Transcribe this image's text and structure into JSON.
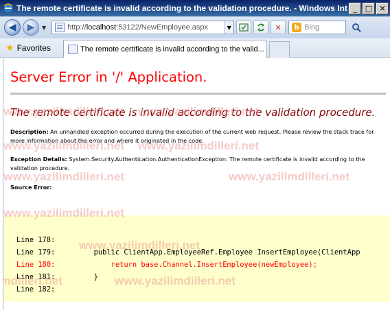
{
  "window": {
    "title": "The remote certificate is invalid according to the validation procedure. - Windows Intern...",
    "controls": {
      "minimize": "_",
      "maximize": "□",
      "close": "✕"
    }
  },
  "navbar": {
    "url_prefix": "http://",
    "url_host": "localhost",
    "url_rest": ":53122/NewEmployee.aspx",
    "search_placeholder": "Bing"
  },
  "favorites": {
    "label": "Favorites"
  },
  "tab": {
    "title": "The remote certificate is invalid according to the valid..."
  },
  "page": {
    "heading": "Server Error in '/' Application.",
    "error_title": "The remote certificate is invalid according to the validation procedure.",
    "description_label": "Description:",
    "description_text": " An unhandled exception occurred during the execution of the current web request. Please review the stack trace for more information about the error and where it originated in the code.",
    "exception_label": "Exception Details:",
    "exception_text": " System.Security.Authentication.AuthenticationException: The remote certificate is invalid according to the validation procedure.",
    "source_error_label": "Source Error:",
    "code_lines": [
      {
        "text": "Line 178:",
        "error": false
      },
      {
        "text": "Line 179:         public ClientApp.EmployeeRef.Employee InsertEmployee(ClientApp",
        "error": false
      },
      {
        "text": "Line 180:             return base.Channel.InsertEmployee(newEmployee);",
        "error": true
      },
      {
        "text": "Line 181:         }",
        "error": false
      },
      {
        "text": "Line 182:",
        "error": false
      }
    ]
  },
  "watermark": "www.yazilimdilleri.net"
}
